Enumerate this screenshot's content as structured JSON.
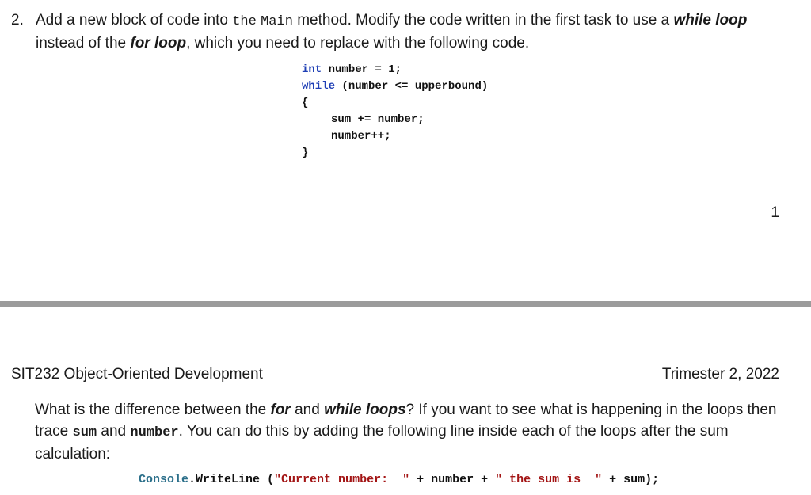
{
  "task2": {
    "number": "2.",
    "t1": "Add a new block of code into ",
    "t2": "the",
    "t3": " ",
    "main_word": "Main",
    "t4": " method.  Modify the code written in the first task to use a ",
    "while_loop": "while loop",
    "t5": " instead of the ",
    "for_loop": "for loop",
    "t6": ", which you need to replace with the following code."
  },
  "code_block": {
    "l1_kw": "int",
    "l1_rest": " number = 1;",
    "l2_kw": "while",
    "l2_rest": " (number <= upperbound)",
    "l3": "{",
    "l4": "sum += number;",
    "l5": "number++;",
    "l6": "}"
  },
  "page_number": "1",
  "header": {
    "left": "SIT232 Object-Oriented Development",
    "right": "Trimester 2, 2022"
  },
  "paragraph": {
    "p1": "What is the difference between the ",
    "for": "for",
    "p2": " and ",
    "while_loops": "while loops",
    "p3": "? If you want to see what is happening in the loops then trace ",
    "sum": "sum",
    "p4": " and ",
    "number": "number",
    "p5": ". You can do this by adding the following line inside each of the loops after the sum calculation:"
  },
  "console_line": {
    "cls": "Console",
    "dot_method": ".WriteLine (",
    "s1": "\"Current number:  \"",
    "mid1": " + number + ",
    "s2": "\" the sum is  \"",
    "end": " + sum);"
  }
}
